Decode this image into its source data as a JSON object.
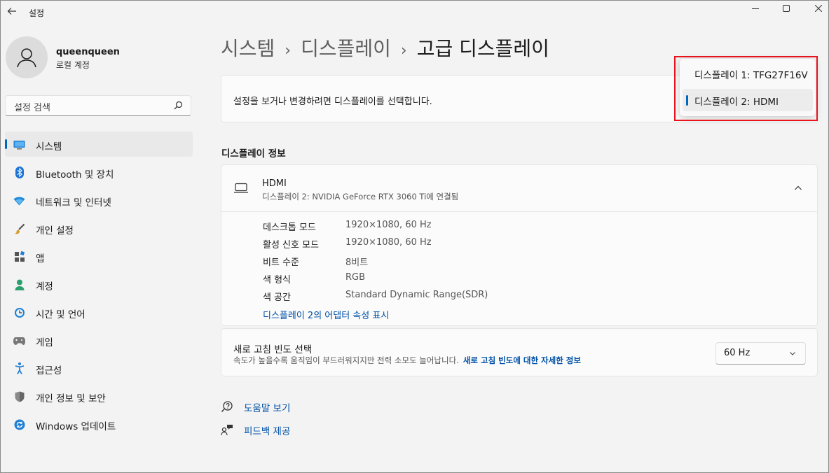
{
  "window": {
    "title": "설정",
    "back_icon": "arrow-left-icon",
    "minimize_icon": "minimize-icon",
    "maximize_icon": "maximize-icon",
    "close_icon": "close-icon"
  },
  "user": {
    "name": "queenqueen",
    "account": "로컬 계정"
  },
  "search": {
    "placeholder": "설정 검색"
  },
  "sidebar": {
    "items": [
      {
        "label": "시스템",
        "icon": "monitor-icon",
        "active": true
      },
      {
        "label": "Bluetooth 및 장치",
        "icon": "bluetooth-icon"
      },
      {
        "label": "네트워크 및 인터넷",
        "icon": "wifi-icon"
      },
      {
        "label": "개인 설정",
        "icon": "brush-icon"
      },
      {
        "label": "앱",
        "icon": "apps-icon"
      },
      {
        "label": "계정",
        "icon": "person-icon"
      },
      {
        "label": "시간 및 언어",
        "icon": "clock-globe-icon"
      },
      {
        "label": "게임",
        "icon": "gamepad-icon"
      },
      {
        "label": "접근성",
        "icon": "accessibility-icon"
      },
      {
        "label": "개인 정보 및 보안",
        "icon": "shield-icon"
      },
      {
        "label": "Windows 업데이트",
        "icon": "update-icon"
      }
    ]
  },
  "breadcrumb": {
    "part1": "시스템",
    "part2": "디스플레이",
    "current": "고급 디스플레이",
    "separator": "›"
  },
  "select_display": {
    "text": "설정을 보거나 변경하려면 디스플레이를 선택합니다."
  },
  "display_info": {
    "section_title": "디스플레이 정보",
    "name": "HDMI",
    "subtitle": "디스플레이 2: NVIDIA GeForce RTX 3060 Ti에 연결됨",
    "rows": [
      {
        "label": "데스크톱 모드",
        "value": "1920×1080, 60 Hz"
      },
      {
        "label": "활성 신호 모드",
        "value": "1920×1080, 60 Hz"
      },
      {
        "label": "비트 수준",
        "value": "8비트"
      },
      {
        "label": "색 형식",
        "value": "RGB"
      },
      {
        "label": "색 공간",
        "value": "Standard Dynamic Range(SDR)"
      }
    ],
    "adapter_link": "디스플레이 2의 어댑터 속성 표시"
  },
  "refresh_rate": {
    "title": "새로 고침 빈도 선택",
    "subtitle": "속도가 높을수록 움직임이 부드러워지지만 전력 소모도 늘어납니다.",
    "link": "새로 고침 빈도에 대한 자세한 정보",
    "value": "60 Hz"
  },
  "help": {
    "get_help": "도움말 보기",
    "feedback": "피드백 제공"
  },
  "flyout": {
    "options": [
      {
        "label": "디스플레이 1: TFG27F16V",
        "selected": false
      },
      {
        "label": "디스플레이 2: HDMI",
        "selected": true
      }
    ]
  },
  "colors": {
    "accent": "#0067c0",
    "link": "#0051a8",
    "highlight_box": "#e8131b"
  }
}
